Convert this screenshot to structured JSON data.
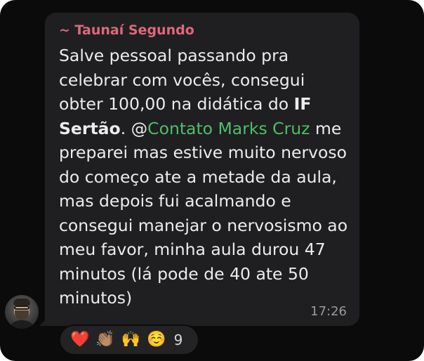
{
  "message": {
    "sender": "~ Taunaí Segundo",
    "text_parts": [
      "Salve pessoal passando pra celebrar com vocês, consegui obter 100,00 na didática do ",
      "IF Sertão",
      ". @",
      "Contato Marks Cruz",
      " me preparei mas estive muito nervoso do começo ate a metade da aula, mas depois fui acalmando e consegui manejar o nervosismo ao meu favor, minha aula durou 47 minutos (lá pode de 40 ate 50 minutos)"
    ],
    "time": "17:26"
  },
  "reactions": {
    "emojis": [
      "❤️",
      "👏🏽",
      "🙌",
      "☺️"
    ],
    "count": "9"
  },
  "colors": {
    "sender": "#e0687a",
    "mention": "#4fbf67",
    "bubble": "#1f1f21",
    "background": "#0b0b0b"
  }
}
